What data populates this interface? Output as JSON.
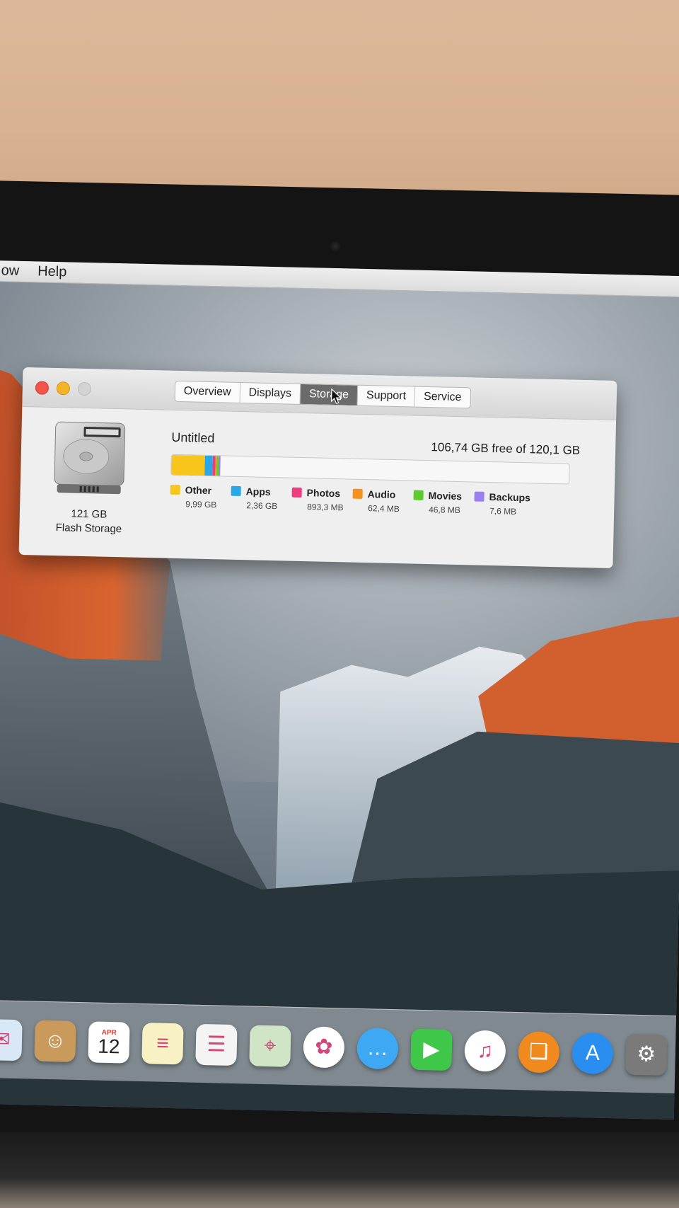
{
  "menubar": {
    "items": [
      "ow",
      "Help"
    ]
  },
  "window": {
    "tabs": [
      {
        "label": "Overview",
        "active": false
      },
      {
        "label": "Displays",
        "active": false
      },
      {
        "label": "Storage",
        "active": true
      },
      {
        "label": "Support",
        "active": false
      },
      {
        "label": "Service",
        "active": false
      }
    ],
    "disk": {
      "capacity": "121 GB",
      "type": "Flash Storage"
    },
    "volume": {
      "name": "Untitled",
      "free_text": "106,74 GB free of 120,1 GB"
    },
    "usage_total_gb": 120.1,
    "categories": [
      {
        "name": "Other",
        "size": "9,99 GB",
        "gb": 9.99,
        "color": "#f7c51c"
      },
      {
        "name": "Apps",
        "size": "2,36 GB",
        "gb": 2.36,
        "color": "#2aa7e6"
      },
      {
        "name": "Photos",
        "size": "893,3 MB",
        "gb": 0.8933,
        "color": "#ef3c7e"
      },
      {
        "name": "Audio",
        "size": "62,4 MB",
        "gb": 0.0624,
        "color": "#f5921e"
      },
      {
        "name": "Movies",
        "size": "46,8 MB",
        "gb": 0.0468,
        "color": "#5ccc2c"
      },
      {
        "name": "Backups",
        "size": "7,6 MB",
        "gb": 0.0076,
        "color": "#9b7ef0"
      }
    ]
  },
  "dock": {
    "items": [
      {
        "icon": "mail-icon"
      },
      {
        "icon": "contacts-icon"
      },
      {
        "icon": "calendar-icon",
        "month": "APR",
        "day": "12"
      },
      {
        "icon": "notes-icon"
      },
      {
        "icon": "reminders-icon"
      },
      {
        "icon": "maps-icon"
      },
      {
        "icon": "photos-icon"
      },
      {
        "icon": "messages-icon"
      },
      {
        "icon": "facetime-icon"
      },
      {
        "icon": "itunes-icon"
      },
      {
        "icon": "ibooks-icon"
      },
      {
        "icon": "app-store-icon"
      },
      {
        "icon": "system-preferences-icon"
      }
    ]
  }
}
